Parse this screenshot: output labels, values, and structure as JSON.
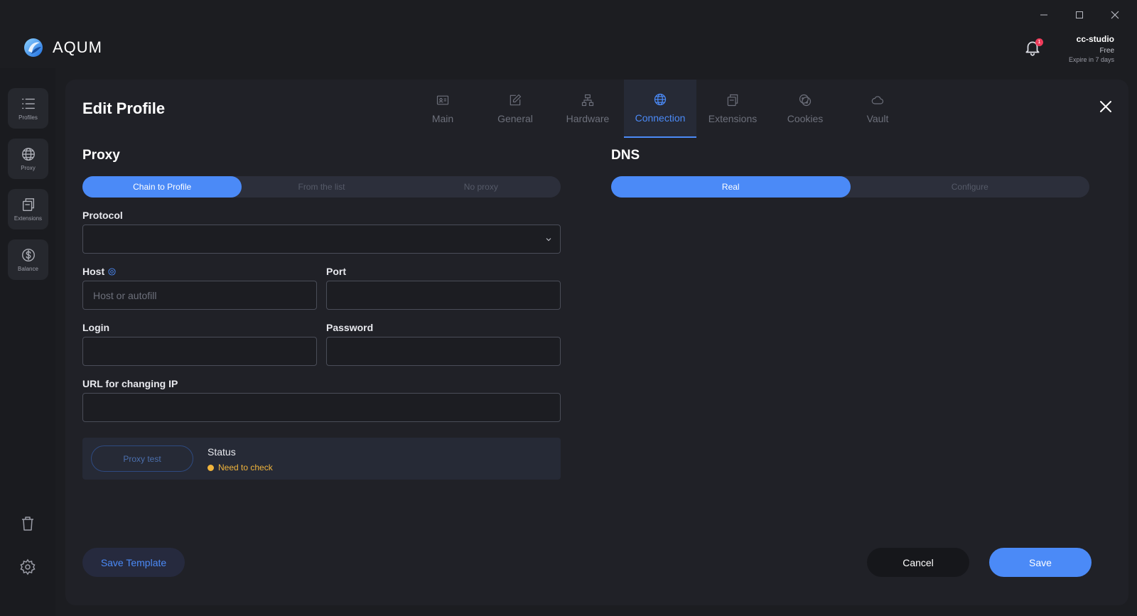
{
  "app": {
    "name": "AQUM"
  },
  "account": {
    "name": "cc-studio",
    "plan": "Free",
    "expire": "Expire in 7 days"
  },
  "notifications": {
    "count": "1"
  },
  "sidebar": {
    "items": [
      {
        "label": "Profiles",
        "icon": "list-icon"
      },
      {
        "label": "Proxy",
        "icon": "globe-icon"
      },
      {
        "label": "Extensions",
        "icon": "extensions-icon"
      },
      {
        "label": "Balance",
        "icon": "dollar-icon"
      }
    ]
  },
  "panel": {
    "title": "Edit Profile"
  },
  "tabs": [
    {
      "label": "Main",
      "icon": "id-card-icon"
    },
    {
      "label": "General",
      "icon": "edit-icon"
    },
    {
      "label": "Hardware",
      "icon": "hierarchy-icon"
    },
    {
      "label": "Connection",
      "icon": "globe-icon",
      "active": true
    },
    {
      "label": "Extensions",
      "icon": "extensions-icon"
    },
    {
      "label": "Cookies",
      "icon": "cookie-icon"
    },
    {
      "label": "Vault",
      "icon": "cloud-icon"
    }
  ],
  "proxy": {
    "title": "Proxy",
    "modes": [
      "Chain to Profile",
      "From the list",
      "No proxy"
    ],
    "active_mode": "Chain to Profile",
    "protocol_label": "Protocol",
    "protocol_value": "",
    "host_label": "Host",
    "host_placeholder": "Host or autofill",
    "port_label": "Port",
    "login_label": "Login",
    "password_label": "Password",
    "url_label": "URL for changing IP",
    "test_button": "Proxy test",
    "status_label": "Status",
    "status_value": "Need to check"
  },
  "dns": {
    "title": "DNS",
    "modes": [
      "Real",
      "Configure"
    ],
    "active_mode": "Real"
  },
  "footer": {
    "save_template": "Save Template",
    "cancel": "Cancel",
    "save": "Save"
  },
  "colors": {
    "accent": "#4b8af7",
    "warning": "#f0b43c",
    "badge": "#ef3b5a",
    "background": "#1c1d21",
    "panel": "#202127"
  }
}
